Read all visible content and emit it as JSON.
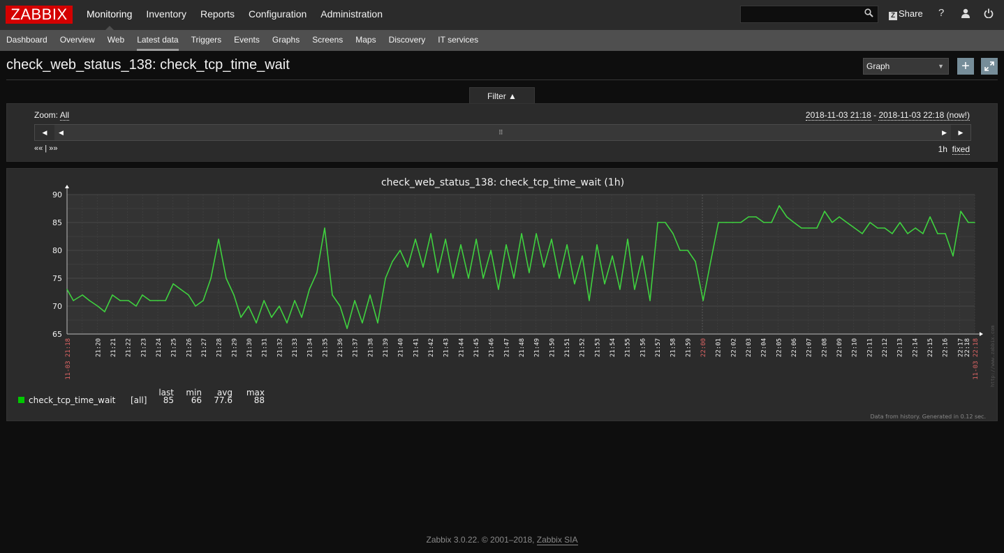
{
  "header": {
    "logo": "ZABBIX",
    "top_menu": [
      {
        "label": "Monitoring",
        "active": true
      },
      {
        "label": "Inventory",
        "active": false
      },
      {
        "label": "Reports",
        "active": false
      },
      {
        "label": "Configuration",
        "active": false
      },
      {
        "label": "Administration",
        "active": false
      }
    ],
    "search": {
      "value": "",
      "placeholder": "",
      "icon": "search-icon"
    },
    "share_label": "Share",
    "share_icon": "Z",
    "help_icon": "?",
    "user_icon": "user-icon",
    "logout_icon": "power-icon"
  },
  "sub_menu": [
    {
      "label": "Dashboard",
      "active": false
    },
    {
      "label": "Overview",
      "active": false
    },
    {
      "label": "Web",
      "active": false
    },
    {
      "label": "Latest data",
      "active": true
    },
    {
      "label": "Triggers",
      "active": false
    },
    {
      "label": "Events",
      "active": false
    },
    {
      "label": "Graphs",
      "active": false
    },
    {
      "label": "Screens",
      "active": false
    },
    {
      "label": "Maps",
      "active": false
    },
    {
      "label": "Discovery",
      "active": false
    },
    {
      "label": "IT services",
      "active": false
    }
  ],
  "page": {
    "title": "check_web_status_138: check_tcp_time_wait",
    "view_select": "Graph",
    "add_button": "+",
    "fullscreen_icon": "fullscreen-icon"
  },
  "filter": {
    "tab_label": "Filter ▲",
    "zoom_label": "Zoom:",
    "zoom_value": "All",
    "range_from": "2018-11-03 21:18",
    "range_sep": " - ",
    "range_to": "2018-11-03 22:18",
    "range_now": "(now!)",
    "nav_back": "«« |",
    "nav_fwd": "»»",
    "period": "1h",
    "fixed_label": "fixed",
    "scroll_left": "◀",
    "scroll_right": "▶",
    "grip": "⠿"
  },
  "chart_data": {
    "type": "line",
    "title": "check_web_status_138: check_tcp_time_wait (1h)",
    "xlabel": "",
    "ylabel": "",
    "ylim": [
      65,
      90
    ],
    "yticks": [
      65,
      70,
      75,
      80,
      85,
      90
    ],
    "xrange_minutes": [
      0,
      60
    ],
    "start_label": "11-03 21:18",
    "end_label": "11-03 22:18",
    "mid_label": "22:00",
    "xtick_labels": [
      "21:20",
      "21:21",
      "21:22",
      "21:23",
      "21:24",
      "21:25",
      "21:26",
      "21:27",
      "21:28",
      "21:29",
      "21:30",
      "21:31",
      "21:32",
      "21:33",
      "21:34",
      "21:35",
      "21:36",
      "21:37",
      "21:38",
      "21:39",
      "21:40",
      "21:41",
      "21:42",
      "21:43",
      "21:44",
      "21:45",
      "21:46",
      "21:47",
      "21:48",
      "21:49",
      "21:50",
      "21:51",
      "21:52",
      "21:53",
      "21:54",
      "21:55",
      "21:56",
      "21:57",
      "21:58",
      "21:59",
      "22:00",
      "22:01",
      "22:02",
      "22:03",
      "22:04",
      "22:05",
      "22:06",
      "22:07",
      "22:08",
      "22:09",
      "22:10",
      "22:11",
      "22:12",
      "22:13",
      "22:14",
      "22:15",
      "22:16",
      "22:17",
      "22:18"
    ],
    "grid": true,
    "series": [
      {
        "name": "check_tcp_time_wait",
        "color": "#00c800",
        "line_color": "#3fd13f",
        "function": "[all]",
        "minutes": [
          0,
          0.42,
          1.02,
          1.48,
          2.03,
          2.49,
          3.0,
          3.51,
          4.06,
          4.57,
          4.98,
          5.49,
          6.0,
          6.51,
          7.02,
          7.52,
          8.03,
          8.49,
          9.0,
          9.51,
          10.02,
          10.52,
          11.03,
          11.49,
          12.0,
          12.51,
          13.02,
          13.52,
          14.03,
          14.54,
          15.05,
          15.51,
          16.02,
          16.52,
          17.03,
          17.54,
          18.05,
          18.51,
          19.02,
          19.52,
          20.03,
          20.54,
          21.05,
          21.51,
          22.02,
          22.52,
          23.03,
          23.54,
          24.05,
          24.51,
          25.02,
          25.52,
          26.03,
          26.54,
          27.05,
          27.51,
          28.02,
          28.52,
          29.03,
          29.54,
          30.05,
          30.55,
          31.02,
          31.52,
          32.03,
          32.54,
          33.05,
          33.55,
          34.06,
          34.52,
          35.03,
          35.54,
          36.05,
          36.55,
          37.06,
          37.52,
          38.03,
          38.54,
          39.05,
          39.55,
          40.06,
          40.52,
          41.03,
          41.54,
          42.05,
          42.55,
          43.06,
          43.57,
          44.03,
          44.54,
          45.05,
          45.55,
          46.06,
          46.57,
          47.08,
          47.58,
          48.05,
          48.55,
          49.06,
          49.57,
          50.08,
          50.58,
          51.05,
          51.55,
          52.06,
          52.57,
          53.08,
          53.58,
          54.05,
          54.55,
          55.06,
          55.57,
          56.08,
          56.58,
          57.05,
          57.55,
          58.06,
          58.57,
          59.08,
          59.58,
          60.0
        ],
        "values": [
          73,
          71,
          72,
          71,
          70,
          69,
          72,
          71,
          71,
          70,
          72,
          71,
          71,
          71,
          74,
          73,
          72,
          70,
          71,
          75,
          82,
          75,
          72,
          68,
          70,
          67,
          71,
          68,
          70,
          67,
          71,
          68,
          73,
          76,
          84,
          72,
          70,
          66,
          71,
          67,
          72,
          67,
          75,
          78,
          80,
          77,
          82,
          77,
          83,
          76,
          82,
          75,
          81,
          75,
          82,
          75,
          80,
          73,
          81,
          75,
          83,
          76,
          83,
          77,
          82,
          75,
          81,
          74,
          79,
          71,
          81,
          74,
          79,
          73,
          82,
          73,
          79,
          71,
          85,
          85,
          83,
          80,
          80,
          78,
          71,
          78,
          85,
          85,
          85,
          85,
          86,
          86,
          85,
          85,
          88,
          86,
          85,
          84,
          84,
          84,
          87,
          85,
          86,
          85,
          84,
          83,
          85,
          84,
          84,
          83,
          85,
          83,
          84,
          83,
          86,
          83,
          83,
          79,
          87,
          85,
          85
        ],
        "last": "85",
        "min": "66",
        "avg": "77.6",
        "max": "88"
      }
    ],
    "legend": {
      "placement": "bottom-left",
      "headers": [
        "last",
        "min",
        "avg",
        "max"
      ]
    },
    "watermark": "http://www.zabbix.com",
    "footnote": "Data from history. Generated in 0.12 sec."
  },
  "footer": {
    "text": "Zabbix 3.0.22. © 2001–2018, ",
    "link": "Zabbix SIA"
  }
}
